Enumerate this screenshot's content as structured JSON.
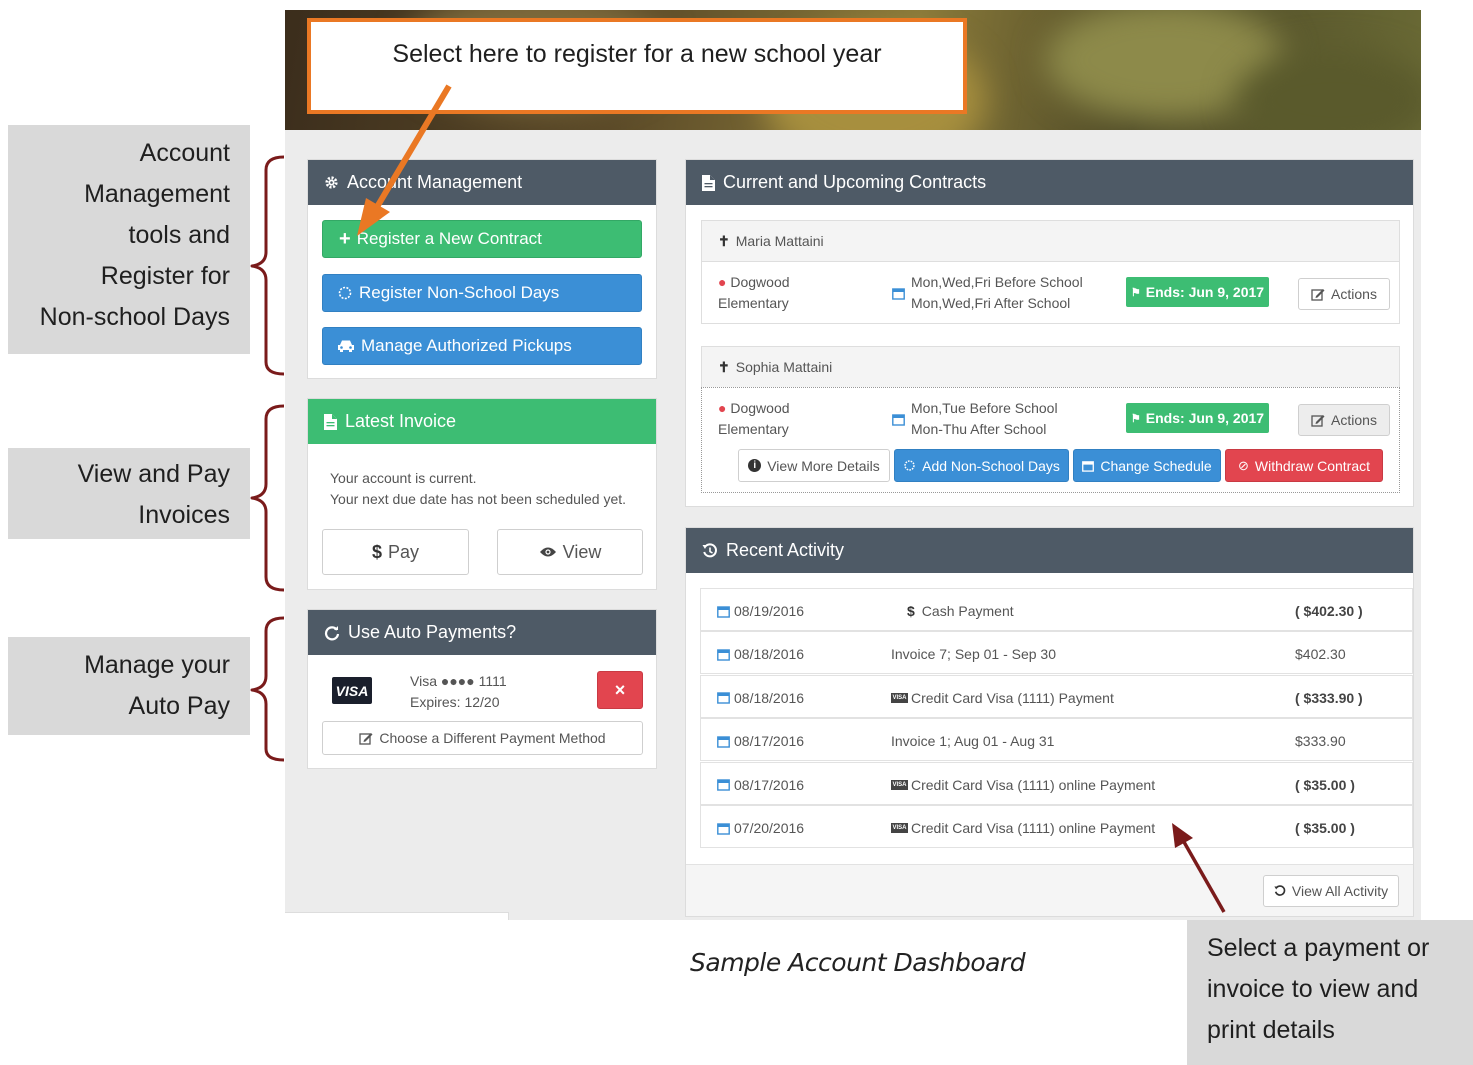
{
  "annotations": {
    "top_callout": "Select here to register for a new school year",
    "account_tools": [
      "Account",
      "Management",
      "tools and",
      "Register for",
      "Non-school Days"
    ],
    "invoices": [
      "View and Pay",
      "Invoices"
    ],
    "autopay": [
      "Manage your",
      "Auto Pay"
    ],
    "payment_details": [
      "Select a payment or",
      "invoice to view and",
      "print details"
    ],
    "caption": "Sample Account Dashboard"
  },
  "account_management": {
    "title": "Account Management",
    "register_new_contract": "Register a New Contract",
    "register_non_school_days": "Register Non-School Days",
    "manage_pickups": "Manage Authorized Pickups"
  },
  "latest_invoice": {
    "title": "Latest Invoice",
    "status_line1": "Your account is current.",
    "status_line2": "Your next due date has not been scheduled yet.",
    "pay_label": "Pay",
    "view_label": "View"
  },
  "auto_payments": {
    "title": "Use Auto Payments?",
    "card_brand": "VISA",
    "card_number": "Visa ●●●● 1111",
    "expires": "Expires: 12/20",
    "remove_label": "×",
    "choose_method": "Choose a Different Payment Method"
  },
  "contracts": {
    "title": "Current and Upcoming Contracts",
    "children": [
      {
        "name": "Maria Mattaini",
        "school_line1": "Dogwood",
        "school_line2": "Elementary",
        "schedule_line1": "Mon,Wed,Fri Before School",
        "schedule_line2": "Mon,Wed,Fri After School",
        "ends": "Ends: Jun 9, 2017",
        "actions": "Actions"
      },
      {
        "name": "Sophia Mattaini",
        "school_line1": "Dogwood",
        "school_line2": "Elementary",
        "schedule_line1": "Mon,Tue Before School",
        "schedule_line2": "Mon-Thu After School",
        "ends": "Ends: Jun 9, 2017",
        "actions": "Actions",
        "view_details": "View More Details",
        "add_non_school": "Add Non-School Days",
        "change_schedule": "Change Schedule",
        "withdraw": "Withdraw Contract"
      }
    ]
  },
  "recent_activity": {
    "title": "Recent Activity",
    "rows": [
      {
        "date": "08/19/2016",
        "icon": "dollar",
        "desc": "Cash  Payment",
        "amount": "( $402.30 )",
        "bold": true
      },
      {
        "date": "08/18/2016",
        "icon": "",
        "desc": "Invoice 7; Sep 01 - Sep 30",
        "amount": "$402.30",
        "bold": false
      },
      {
        "date": "08/18/2016",
        "icon": "visa",
        "desc": "Credit Card Visa (1111)  Payment",
        "amount": "( $333.90 )",
        "bold": true
      },
      {
        "date": "08/17/2016",
        "icon": "",
        "desc": "Invoice 1; Aug 01 - Aug 31",
        "amount": "$333.90",
        "bold": false
      },
      {
        "date": "08/17/2016",
        "icon": "visa",
        "desc": "Credit Card Visa (1111) online  Payment",
        "amount": "( $35.00 )",
        "bold": true
      },
      {
        "date": "07/20/2016",
        "icon": "visa",
        "desc": "Credit Card Visa (1111) online  Payment",
        "amount": "( $35.00 )",
        "bold": true
      }
    ],
    "view_all": "View All Activity"
  },
  "colors": {
    "panel_header": "#4e5a66",
    "green": "#3dbd73",
    "blue": "#3b8fd6",
    "red": "#e2454f",
    "orange": "#ea7824",
    "bracket": "#7a1b1b"
  }
}
